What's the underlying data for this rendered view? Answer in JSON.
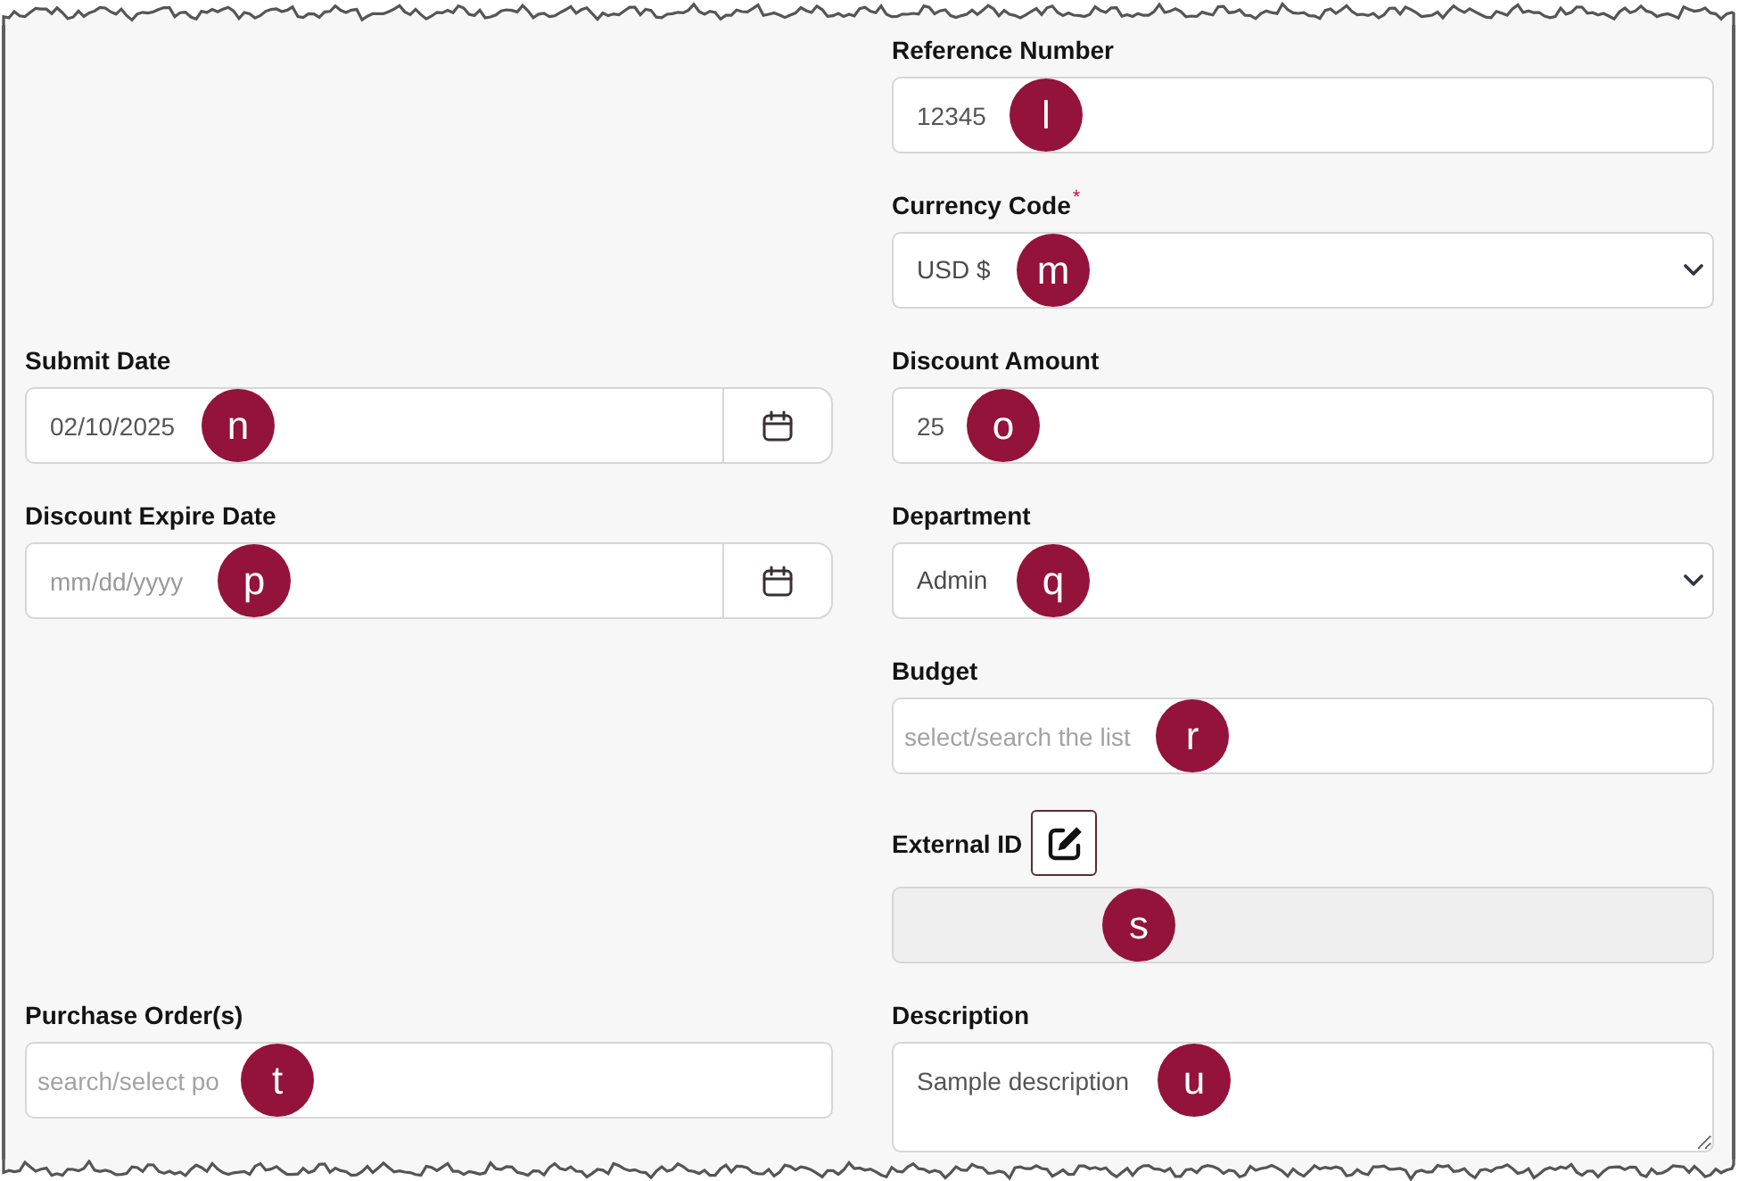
{
  "form": {
    "rows": [
      {
        "right": {
          "label": "Reference Number",
          "kind": "text",
          "value": "12345",
          "disabled": false,
          "callout": "l"
        }
      },
      {
        "right": {
          "label": "Currency Code",
          "required_mark": "*",
          "kind": "select",
          "value": "USD $",
          "disabled": false,
          "callout": "m"
        }
      },
      {
        "left": {
          "label": "Submit Date",
          "kind": "date",
          "value": "02/10/2025",
          "disabled": false,
          "callout": "n"
        },
        "right": {
          "label": "Discount Amount",
          "kind": "text",
          "value": "25",
          "disabled": false,
          "callout": "o"
        }
      },
      {
        "left": {
          "label": "Discount Expire Date",
          "kind": "date",
          "placeholder": "mm/dd/yyyy",
          "disabled": false,
          "callout": "p"
        },
        "right": {
          "label": "Department",
          "kind": "select",
          "value": "Admin",
          "disabled": false,
          "callout": "q"
        }
      },
      {
        "right": {
          "label": "Budget",
          "kind": "search",
          "placeholder": "select/search the list",
          "disabled": false,
          "callout": "r"
        }
      },
      {
        "right": {
          "label": "External ID",
          "kind": "text",
          "edit_button": true,
          "disabled": true,
          "callout": "s"
        }
      },
      {
        "left": {
          "label": "Purchase Order(s)",
          "kind": "search",
          "placeholder": "search/select po",
          "disabled": false,
          "callout": "t"
        },
        "right": {
          "label": "Description",
          "kind": "textarea",
          "value": "Sample description",
          "disabled": false,
          "callout": "u"
        }
      }
    ]
  }
}
